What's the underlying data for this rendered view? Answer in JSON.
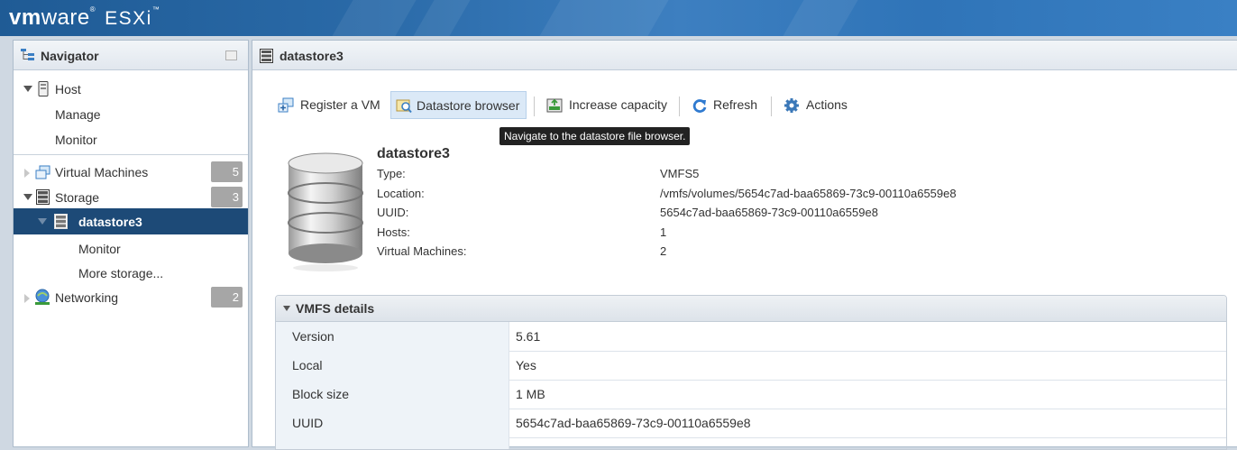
{
  "header": {
    "brand_vm": "vm",
    "brand_ware": "ware",
    "brand_tm": "®",
    "product": "ESXi",
    "product_tm": "™"
  },
  "navigator": {
    "title": "Navigator",
    "host": {
      "label": "Host",
      "manage": "Manage",
      "monitor": "Monitor"
    },
    "virtual_machines": {
      "label": "Virtual Machines",
      "count": "5"
    },
    "storage": {
      "label": "Storage",
      "count": "3"
    },
    "datastore": {
      "label": "datastore3",
      "monitor": "Monitor",
      "more": "More storage..."
    },
    "networking": {
      "label": "Networking",
      "count": "2"
    }
  },
  "main": {
    "title": "datastore3",
    "toolbar": {
      "register_vm": "Register a VM",
      "datastore_browser": "Datastore browser",
      "increase_capacity": "Increase capacity",
      "refresh": "Refresh",
      "actions": "Actions"
    },
    "tooltip": "Navigate to the datastore file browser.",
    "info": {
      "name": "datastore3",
      "type_label": "Type:",
      "type_value": "VMFS5",
      "location_label": "Location:",
      "location_value": "/vmfs/volumes/5654c7ad-baa65869-73c9-00110a6559e8",
      "uuid_label": "UUID:",
      "uuid_value": "5654c7ad-baa65869-73c9-00110a6559e8",
      "hosts_label": "Hosts:",
      "hosts_value": "1",
      "vms_label": "Virtual Machines:",
      "vms_value": "2"
    },
    "vmfs_details": {
      "title": "VMFS details",
      "rows": [
        {
          "key": "Version",
          "value": "5.61"
        },
        {
          "key": "Local",
          "value": "Yes"
        },
        {
          "key": "Block size",
          "value": "1 MB"
        },
        {
          "key": "UUID",
          "value": "5654c7ad-baa65869-73c9-00110a6559e8"
        }
      ]
    }
  }
}
